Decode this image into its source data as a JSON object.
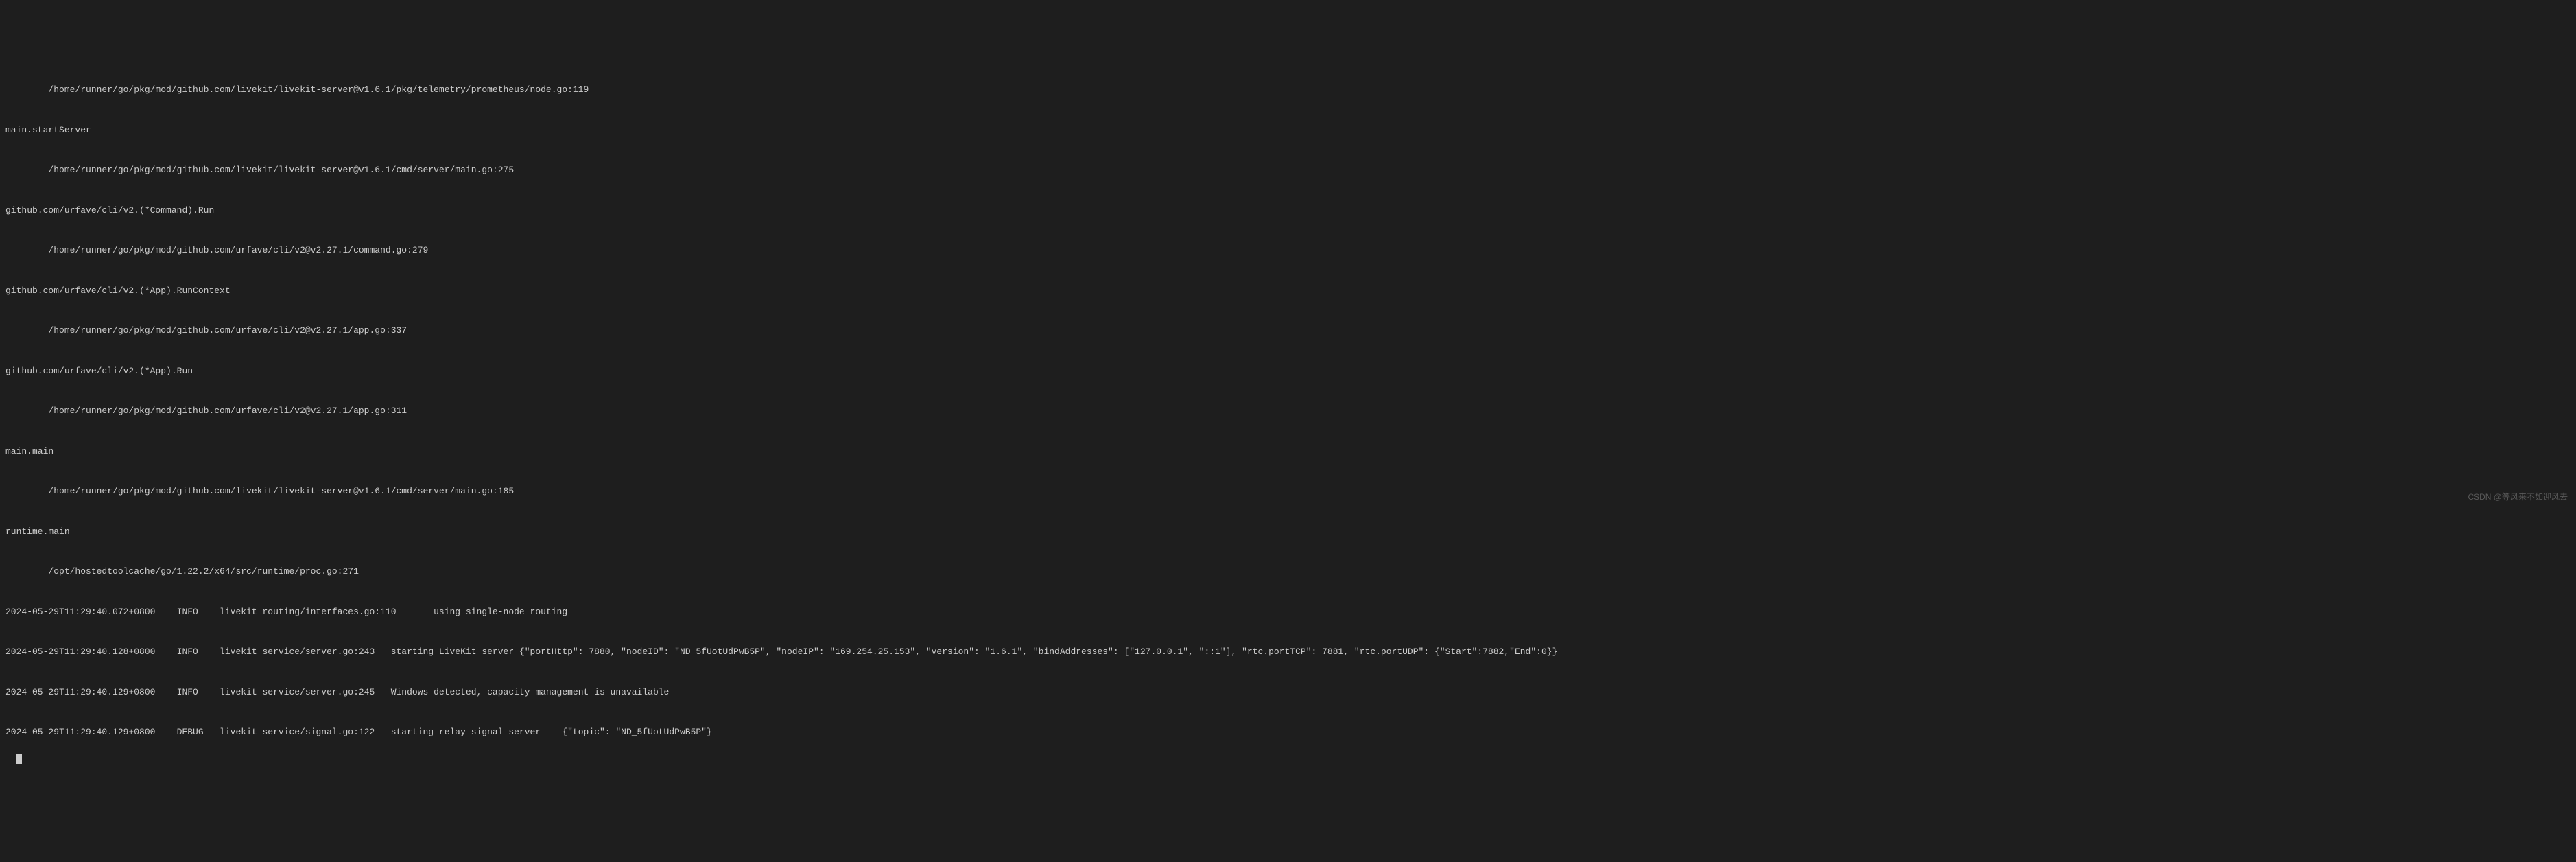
{
  "terminal": {
    "lines": [
      "        /home/runner/go/pkg/mod/github.com/livekit/livekit-server@v1.6.1/pkg/telemetry/prometheus/node.go:119",
      "main.startServer",
      "        /home/runner/go/pkg/mod/github.com/livekit/livekit-server@v1.6.1/cmd/server/main.go:275",
      "github.com/urfave/cli/v2.(*Command).Run",
      "        /home/runner/go/pkg/mod/github.com/urfave/cli/v2@v2.27.1/command.go:279",
      "github.com/urfave/cli/v2.(*App).RunContext",
      "        /home/runner/go/pkg/mod/github.com/urfave/cli/v2@v2.27.1/app.go:337",
      "github.com/urfave/cli/v2.(*App).Run",
      "        /home/runner/go/pkg/mod/github.com/urfave/cli/v2@v2.27.1/app.go:311",
      "main.main",
      "        /home/runner/go/pkg/mod/github.com/livekit/livekit-server@v1.6.1/cmd/server/main.go:185",
      "runtime.main",
      "        /opt/hostedtoolcache/go/1.22.2/x64/src/runtime/proc.go:271",
      "2024-05-29T11:29:40.072+0800    INFO    livekit routing/interfaces.go:110       using single-node routing",
      "2024-05-29T11:29:40.128+0800    INFO    livekit service/server.go:243   starting LiveKit server {\"portHttp\": 7880, \"nodeID\": \"ND_5fUotUdPwB5P\", \"nodeIP\": \"169.254.25.153\", \"version\": \"1.6.1\", \"bindAddresses\": [\"127.0.0.1\", \"::1\"], \"rtc.portTCP\": 7881, \"rtc.portUDP\": {\"Start\":7882,\"End\":0}}",
      "2024-05-29T11:29:40.129+0800    INFO    livekit service/server.go:245   Windows detected, capacity management is unavailable",
      "2024-05-29T11:29:40.129+0800    DEBUG   livekit service/signal.go:122   starting relay signal server    {\"topic\": \"ND_5fUotUdPwB5P\"}"
    ]
  },
  "watermark": "CSDN @等风来不如迎风去"
}
